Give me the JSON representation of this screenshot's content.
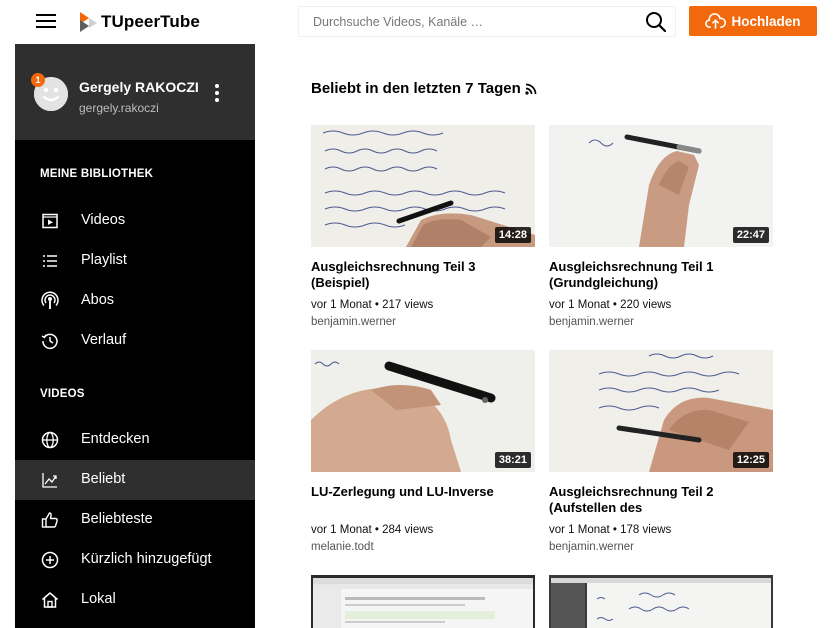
{
  "header": {
    "logo_text": "TUpeerTube",
    "search_placeholder": "Durchsuche Videos, Kanäle …",
    "upload_label": "Hochladen",
    "accent_color": "#f2690d"
  },
  "user": {
    "name": "Gergely RAKOCZI",
    "handle": "gergely.rakoczi",
    "notification_count": "1"
  },
  "sidebar": {
    "library_title": "MEINE BIBLIOTHEK",
    "library_items": [
      {
        "label": "Videos",
        "icon": "videos-icon"
      },
      {
        "label": "Playlist",
        "icon": "playlist-icon"
      },
      {
        "label": "Abos",
        "icon": "subscriptions-icon"
      },
      {
        "label": "Verlauf",
        "icon": "history-icon"
      }
    ],
    "videos_title": "VIDEOS",
    "videos_items": [
      {
        "label": "Entdecken",
        "icon": "globe-icon"
      },
      {
        "label": "Beliebt",
        "icon": "trending-icon",
        "active": true
      },
      {
        "label": "Beliebteste",
        "icon": "thumbs-up-icon"
      },
      {
        "label": "Kürzlich hinzugefügt",
        "icon": "plus-circle-icon"
      },
      {
        "label": "Lokal",
        "icon": "home-icon"
      }
    ]
  },
  "main": {
    "title": "Beliebt in den letzten 7 Tagen",
    "videos": [
      {
        "title": "Ausgleichsrechnung Teil 3 (Beispiel)",
        "duration": "14:28",
        "meta": "vor 1 Monat • 217 views",
        "channel": "benjamin.werner"
      },
      {
        "title": "Ausgleichsrechnung Teil 1 (Grundgleichung)",
        "duration": "22:47",
        "meta": "vor 1 Monat • 220 views",
        "channel": "benjamin.werner"
      },
      {
        "title": "LU-Zerlegung und LU-Inverse",
        "duration": "38:21",
        "meta": "vor 1 Monat • 284 views",
        "channel": "melanie.todt"
      },
      {
        "title": "Ausgleichsrechnung Teil 2 (Aufstellen des",
        "duration": "12:25",
        "meta": "vor 1 Monat • 178 views",
        "channel": "benjamin.werner"
      }
    ]
  }
}
